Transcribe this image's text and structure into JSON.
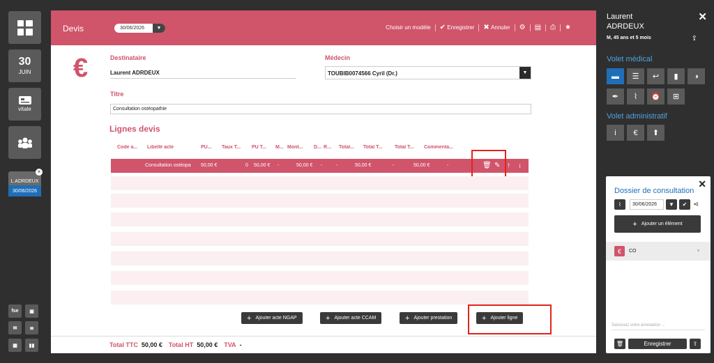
{
  "rail": {
    "date_day": "30",
    "date_month": "JUIN",
    "card_label": "vitale",
    "folder_name": "L.ADRDEUX",
    "folder_date": "30/06/2026",
    "mini_fse": "fse"
  },
  "header": {
    "title": "Devis",
    "date": "30/06/2026",
    "choose_model": "Choisir un modèle",
    "save": "Enregistrer",
    "cancel": "Annuler"
  },
  "form": {
    "destinataire_label": "Destinataire",
    "destinataire_value": "Laurent ADRDEUX",
    "medecin_label": "Médecin",
    "medecin_value": "TOUBIB0074566 Cyril (Dr.)",
    "titre_label": "Titre",
    "titre_value": "Consultation ostéopathie"
  },
  "lines": {
    "section_title": "Lignes devis",
    "columns": [
      "Code a...",
      "Libellé acte",
      "PU...",
      "Taux T...",
      "PU T...",
      "M...",
      "Mont...",
      "D...",
      "R...",
      "Total...",
      "Total T...",
      "Total T...",
      "Commenta..."
    ],
    "row": {
      "libelle": "Consultation ostéopa",
      "pu": "50,00 €",
      "taux": "0",
      "put": "50,00 €",
      "m": "-",
      "montant": "50,00 €",
      "d": "-",
      "r": "-",
      "total": "50,00 €",
      "total_t1": "-",
      "total_t2": "50,00 €",
      "comment": "-"
    }
  },
  "buttons": {
    "ngap": "Ajouter acte NGAP",
    "ccam": "Ajouter acte CCAM",
    "prestation": "Ajouter prestation",
    "ligne": "Ajouter ligne"
  },
  "footer": {
    "ttc_label": "Total TTC",
    "ttc_value": "50,00 €",
    "ht_label": "Total HT",
    "ht_value": "50,00 €",
    "tva_label": "TVA",
    "tva_value": "-"
  },
  "patient": {
    "first_name": "Laurent",
    "last_name": "ADRDEUX",
    "info": "M, 45 ans et 5 mois",
    "medical_section": "Volet médical",
    "admin_section": "Volet administratif"
  },
  "dossier": {
    "title": "Dossier de consultation",
    "date": "30/06/2026",
    "add_element": "Ajouter un élément",
    "item": "CO",
    "annotation_placeholder": "Saisissez votre annotation ...",
    "save": "Enregistrer"
  },
  "colors": {
    "accent": "#d0546a",
    "blue": "#1f6fb8"
  }
}
